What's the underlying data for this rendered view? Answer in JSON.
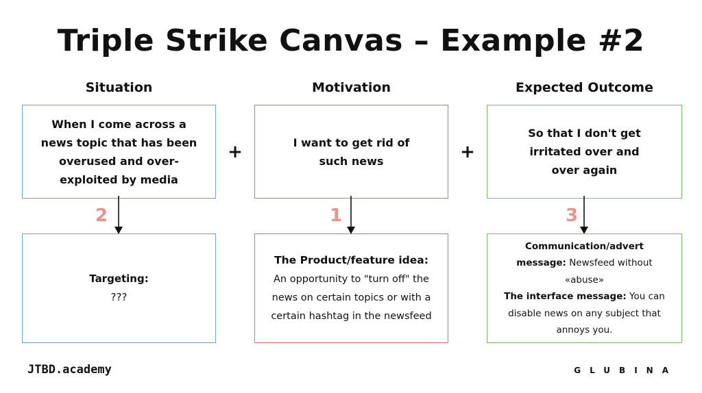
{
  "title": "Triple Strike Canvas – Example #2",
  "columns": {
    "situation": {
      "header": "Situation",
      "top_lines": [
        "When I come across a",
        "news topic that has been",
        "overused and over-",
        "exploited by media"
      ],
      "number": "2",
      "bottom_label": "Targeting:",
      "bottom_value": "???"
    },
    "motivation": {
      "header": "Motivation",
      "top_lines": [
        "I want to get rid of",
        "such news"
      ],
      "number": "1",
      "bottom_label": "The Product/feature idea:",
      "bottom_lines": [
        "An opportunity to \"turn off\" the",
        "news on certain topics or with a",
        "certain hashtag in the newsfeed"
      ]
    },
    "outcome": {
      "header": "Expected Outcome",
      "top_lines": [
        "So that I don't get",
        "irritated over and",
        "over again"
      ],
      "number": "3",
      "comm_label_1": "Communication/advert",
      "comm_label_2": "message:",
      "comm_value_1": " Newsfeed without",
      "comm_value_2": "«abuse»",
      "iface_label": "The interface message:",
      "iface_value_1": " You can",
      "iface_value_2": "disable news on any subject that",
      "iface_value_3": "annoys you."
    }
  },
  "plus_sign": "+",
  "footer": {
    "left": "JTBD.academy",
    "right": "GLUBINA"
  },
  "colors": {
    "situation_border": "#6fa2dc",
    "motivation_border": "#de6f64",
    "outcome_border": "#7cbf5c",
    "number_color": "#e6958c"
  }
}
